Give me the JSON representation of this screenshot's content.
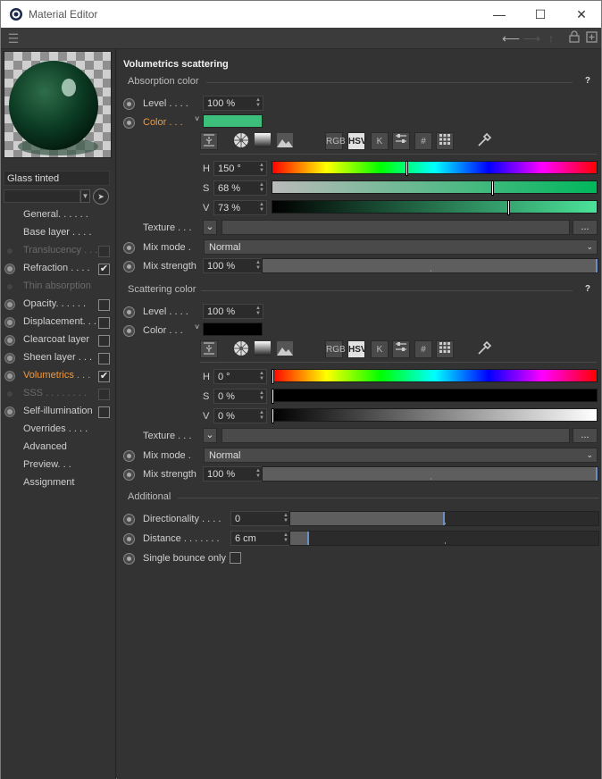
{
  "window": {
    "title": "Material Editor"
  },
  "material": {
    "name": "Glass tinted"
  },
  "sidebar": {
    "items": [
      {
        "label": "General. . . . . .",
        "radio": false,
        "checkbox": false,
        "state": "normal"
      },
      {
        "label": "Base layer . . . .",
        "radio": false,
        "checkbox": false,
        "state": "normal"
      },
      {
        "label": "Translucency . . .",
        "radio": "dim",
        "checkbox": "off",
        "state": "dim"
      },
      {
        "label": "Refraction . . . .",
        "radio": true,
        "checkbox": "on",
        "state": "normal"
      },
      {
        "label": "Thin absorption",
        "radio": "dim",
        "checkbox": false,
        "state": "dim"
      },
      {
        "label": "Opacity. . . . . .",
        "radio": true,
        "checkbox": "off",
        "state": "normal"
      },
      {
        "label": "Displacement. . .",
        "radio": true,
        "checkbox": "off",
        "state": "normal"
      },
      {
        "label": "Clearcoat layer",
        "radio": true,
        "checkbox": "off",
        "state": "normal"
      },
      {
        "label": "Sheen layer . . .",
        "radio": true,
        "checkbox": "off",
        "state": "normal"
      },
      {
        "label": "Volumetrics . . .",
        "radio": true,
        "checkbox": "on",
        "state": "active"
      },
      {
        "label": "SSS  . . . . . . . .",
        "radio": "dim",
        "checkbox": "off",
        "state": "dim"
      },
      {
        "label": "Self-illumination",
        "radio": true,
        "checkbox": "off",
        "state": "normal"
      },
      {
        "label": "Overrides  . . . .",
        "radio": false,
        "checkbox": false,
        "state": "normal"
      },
      {
        "label": "Advanced",
        "radio": false,
        "checkbox": false,
        "state": "normal"
      },
      {
        "label": "Preview. . .",
        "radio": false,
        "checkbox": false,
        "state": "normal"
      },
      {
        "label": "Assignment",
        "radio": false,
        "checkbox": false,
        "state": "normal"
      }
    ]
  },
  "main": {
    "section_title": "Volumetrics scattering",
    "help": "?",
    "icons": {
      "rgb": "RGB",
      "hsv": "HSV",
      "k": "K",
      "hash": "#"
    },
    "absorption": {
      "header": "Absorption color",
      "level_label": "Level  . . . .",
      "level": "100 %",
      "color_label": "Color  . . .",
      "color_hex": "#3cbf7a",
      "h_label": "H",
      "h": "150 °",
      "h_frac": 0.417,
      "s_label": "S",
      "s": "68 %",
      "s_frac": 0.68,
      "v_label": "V",
      "v": "73 %",
      "v_frac": 0.73,
      "texture_label": "Texture . . .",
      "more": "...",
      "mix_mode_label": "Mix mode .",
      "mix_mode": "Normal",
      "mix_strength_label": "Mix strength",
      "mix_strength": "100 %",
      "mix_strength_frac": 1.0
    },
    "scattering": {
      "header": "Scattering color",
      "level_label": "Level  . . . .",
      "level": "100 %",
      "color_label": "Color  . . .",
      "color_hex": "#000000",
      "h_label": "H",
      "h": "0 °",
      "s_label": "S",
      "s": "0 %",
      "v_label": "V",
      "v": "0 %",
      "texture_label": "Texture . . .",
      "more": "...",
      "mix_mode_label": "Mix mode .",
      "mix_mode": "Normal",
      "mix_strength_label": "Mix strength",
      "mix_strength": "100 %",
      "mix_strength_frac": 1.0
    },
    "additional": {
      "header": "Additional",
      "directionality_label": "Directionality . . . .",
      "directionality": "0",
      "directionality_frac": 0.5,
      "distance_label": "Distance . . . . . . .",
      "distance": "6 cm",
      "distance_frac": 0.06,
      "single_bounce_label": "Single bounce only"
    }
  },
  "colors": {
    "accent": "#f09a3e",
    "slider_marker": "#6b8fc4"
  }
}
